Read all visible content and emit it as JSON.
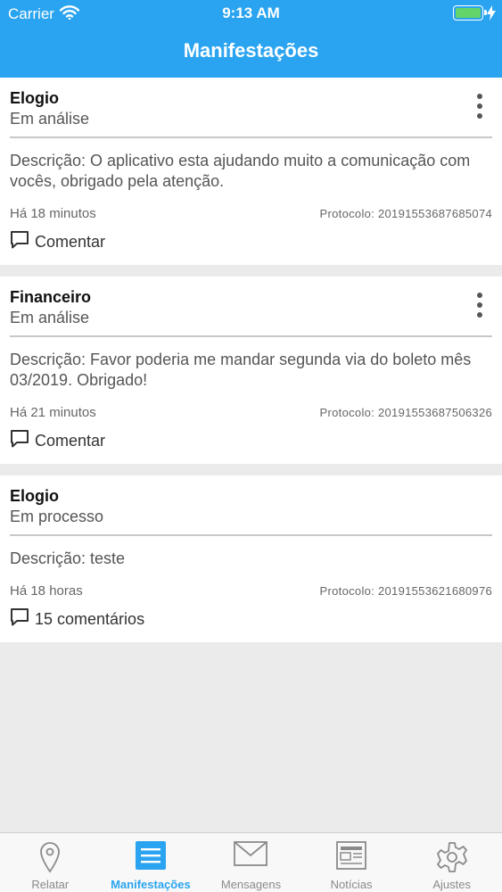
{
  "status_bar": {
    "carrier": "Carrier",
    "time": "9:13 AM"
  },
  "header": {
    "title": "Manifestações"
  },
  "manifestations": [
    {
      "type": "Elogio",
      "status": "Em análise",
      "description": "Descrição: O aplicativo esta ajudando muito a comunicação com vocês, obrigado pela atenção.",
      "time_ago": "Há 18 minutos",
      "protocol": "Protocolo: 20191553687685074",
      "comment_label": "Comentar",
      "has_menu": true
    },
    {
      "type": "Financeiro",
      "status": "Em análise",
      "description": "Descrição: Favor poderia me mandar segunda via do boleto mês 03/2019. Obrigado!",
      "time_ago": "Há 21 minutos",
      "protocol": "Protocolo: 20191553687506326",
      "comment_label": "Comentar",
      "has_menu": true
    },
    {
      "type": "Elogio",
      "status": "Em processo",
      "description": "Descrição: teste",
      "time_ago": "Há 18 horas",
      "protocol": "Protocolo: 20191553621680976",
      "comment_label": "15 comentários",
      "has_menu": false
    }
  ],
  "tabbar": {
    "items": [
      {
        "label": "Relatar",
        "icon": "map-pin-icon",
        "active": false
      },
      {
        "label": "Manifestações",
        "icon": "list-icon",
        "active": true
      },
      {
        "label": "Mensagens",
        "icon": "envelope-icon",
        "active": false
      },
      {
        "label": "Notícias",
        "icon": "newspaper-icon",
        "active": false
      },
      {
        "label": "Ajustes",
        "icon": "gear-icon",
        "active": false
      }
    ]
  },
  "colors": {
    "accent": "#2aa4f0",
    "battery": "#62d46a",
    "background": "#ebebeb"
  }
}
